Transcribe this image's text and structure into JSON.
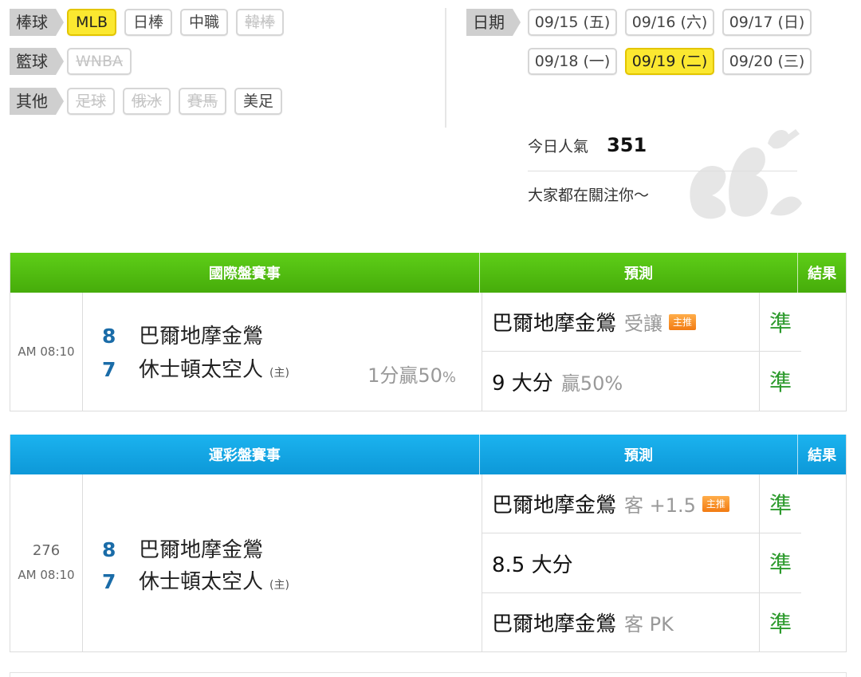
{
  "filters": {
    "baseball": {
      "label": "棒球",
      "items": [
        {
          "label": "MLB",
          "state": "active"
        },
        {
          "label": "日棒",
          "state": "normal"
        },
        {
          "label": "中職",
          "state": "normal"
        },
        {
          "label": "韓棒",
          "state": "disabled"
        }
      ]
    },
    "basketball": {
      "label": "籃球",
      "items": [
        {
          "label": "WNBA",
          "state": "disabled"
        }
      ]
    },
    "other": {
      "label": "其他",
      "items": [
        {
          "label": "足球",
          "state": "disabled"
        },
        {
          "label": "俄冰",
          "state": "disabled"
        },
        {
          "label": "賽馬",
          "state": "disabled"
        },
        {
          "label": "美足",
          "state": "normal"
        }
      ]
    },
    "date": {
      "label": "日期",
      "items": [
        {
          "label": "09/15 (五)",
          "state": "normal"
        },
        {
          "label": "09/16 (六)",
          "state": "normal"
        },
        {
          "label": "09/17 (日)",
          "state": "normal"
        },
        {
          "label": "09/18 (一)",
          "state": "normal"
        },
        {
          "label": "09/19 (二)",
          "state": "active"
        },
        {
          "label": "09/20 (三)",
          "state": "normal"
        }
      ]
    }
  },
  "popularity": {
    "label": "今日人氣",
    "value": "351",
    "subtitle": "大家都在關注你～"
  },
  "international": {
    "headers": {
      "event": "國際盤賽事",
      "prediction": "預測",
      "result": "結果"
    },
    "match": {
      "time": "AM 08:10",
      "away": {
        "score": "8",
        "name": "巴爾地摩金鶯"
      },
      "home": {
        "score": "7",
        "name": "休士頓太空人",
        "mark": "(主)"
      },
      "odds": "1分贏50",
      "odds_unit": "%"
    },
    "predictions": [
      {
        "main": "巴爾地摩金鶯",
        "detail": "受讓",
        "badge": "主推",
        "result": "準"
      },
      {
        "main": "9 大分",
        "detail": "贏50%",
        "badge": "",
        "result": "準"
      }
    ]
  },
  "lottery": {
    "headers": {
      "event": "運彩盤賽事",
      "prediction": "預測",
      "result": "結果"
    },
    "match": {
      "number": "276",
      "time": "AM 08:10",
      "away": {
        "score": "8",
        "name": "巴爾地摩金鶯"
      },
      "home": {
        "score": "7",
        "name": "休士頓太空人",
        "mark": "(主)"
      }
    },
    "predictions": [
      {
        "main": "巴爾地摩金鶯",
        "detail": "客 +1.5",
        "badge": "主推",
        "result": "準"
      },
      {
        "main": "8.5 大分",
        "detail": "",
        "badge": "",
        "result": "準"
      },
      {
        "main": "巴爾地摩金鶯",
        "detail": "客 PK",
        "badge": "",
        "result": "準"
      }
    ]
  },
  "colors": {
    "active_chip": "#fbe830",
    "green_header": "#4fb710",
    "blue_header": "#12a6e6",
    "result_text": "#2c9a2c",
    "score_text": "#1a6ca8"
  }
}
